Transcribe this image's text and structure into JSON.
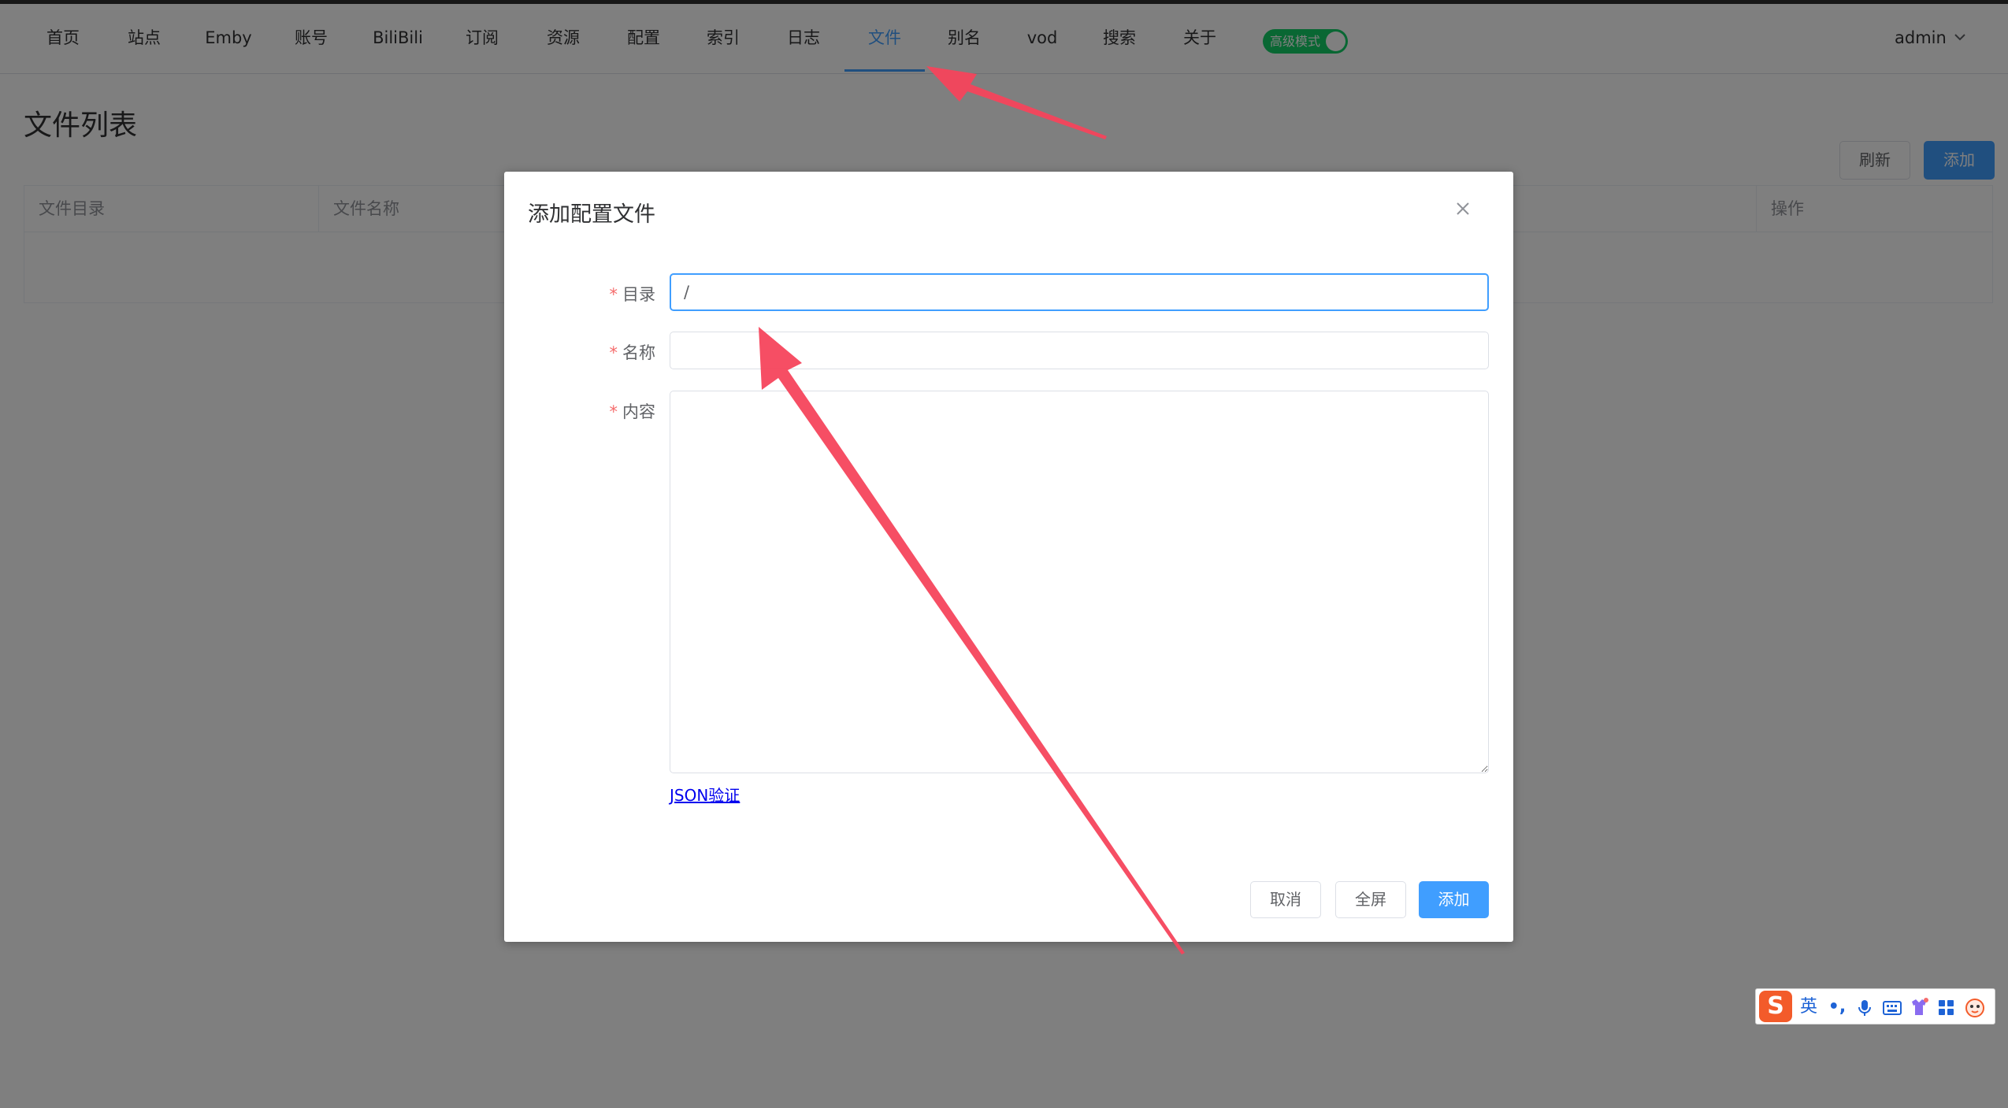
{
  "nav": {
    "items": [
      {
        "label": "首页"
      },
      {
        "label": "站点"
      },
      {
        "label": "Emby"
      },
      {
        "label": "账号"
      },
      {
        "label": "BiliBili"
      },
      {
        "label": "订阅"
      },
      {
        "label": "资源"
      },
      {
        "label": "配置"
      },
      {
        "label": "索引"
      },
      {
        "label": "日志"
      },
      {
        "label": "文件",
        "active": true
      },
      {
        "label": "别名"
      },
      {
        "label": "vod"
      },
      {
        "label": "搜索"
      },
      {
        "label": "关于"
      }
    ],
    "mode_toggle": {
      "label": "高级模式",
      "on": true
    },
    "user": "admin"
  },
  "page": {
    "title": "文件列表",
    "refresh_label": "刷新",
    "add_label": "添加",
    "table_headers": [
      "文件目录",
      "文件名称",
      "操作"
    ]
  },
  "dialog": {
    "title": "添加配置文件",
    "fields": {
      "dir": {
        "label": "目录",
        "value": "/"
      },
      "name": {
        "label": "名称",
        "value": ""
      },
      "content": {
        "label": "内容",
        "value": ""
      }
    },
    "json_link": "JSON验证",
    "cancel_label": "取消",
    "fullscreen_label": "全屏",
    "submit_label": "添加"
  },
  "ime": {
    "logo": "S",
    "lang": "英",
    "punct": "•,"
  },
  "colors": {
    "primary": "#409eff",
    "toggle_on": "#13ce66",
    "required": "#f56c6c",
    "annotation_arrow": "#f5455c"
  }
}
